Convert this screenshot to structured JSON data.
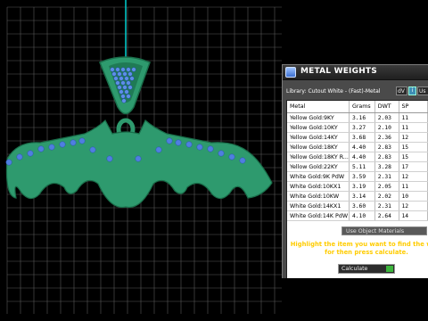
{
  "panel": {
    "title": "METAL WEIGHTS",
    "library_text": "Library: Cutout White - (Fast)-Metal",
    "units_select": "dV",
    "info_btn": "i",
    "units_btn2": "Us",
    "columns": [
      "Metal",
      "Grams",
      "DWT",
      "SP"
    ],
    "rows": [
      {
        "metal": "Yellow Gold:9KY",
        "grams": "3.16",
        "dwt": "2.03",
        "sp": "11"
      },
      {
        "metal": "Yellow Gold:10KY",
        "grams": "3.27",
        "dwt": "2.10",
        "sp": "11"
      },
      {
        "metal": "Yellow Gold:14KY",
        "grams": "3.68",
        "dwt": "2.36",
        "sp": "12"
      },
      {
        "metal": "Yellow Gold:18KY",
        "grams": "4.40",
        "dwt": "2.83",
        "sp": "15"
      },
      {
        "metal": "Yellow Gold:18KY R...",
        "grams": "4.40",
        "dwt": "2.83",
        "sp": "15"
      },
      {
        "metal": "Yellow Gold:22KY",
        "grams": "5.11",
        "dwt": "3.28",
        "sp": "17"
      },
      {
        "metal": "White Gold:9K PdW",
        "grams": "3.59",
        "dwt": "2.31",
        "sp": "12"
      },
      {
        "metal": "White Gold:10KX1",
        "grams": "3.19",
        "dwt": "2.05",
        "sp": "11"
      },
      {
        "metal": "White Gold:10KW",
        "grams": "3.14",
        "dwt": "2.02",
        "sp": "10"
      },
      {
        "metal": "White Gold:14KX1",
        "grams": "3.60",
        "dwt": "2.31",
        "sp": "12"
      },
      {
        "metal": "White Gold:14K PdW",
        "grams": "4.10",
        "dwt": "2.64",
        "sp": "14"
      }
    ],
    "use_object_materials": "Use Object Materials",
    "instructions_line1": "Highlight the item you want to find the weig",
    "instructions_line2": "for then press calculate.",
    "calculate_label": "Calculate"
  },
  "colors": {
    "viewport_bg": "#000000",
    "grid_lines": "#5a5a5a",
    "model_green": "#2e9a6e",
    "model_edge": "#1a6e4a",
    "gem_blue": "#4f7fe0",
    "axis_cyan": "#00d0d0",
    "instruction_text": "#ffcc00"
  }
}
